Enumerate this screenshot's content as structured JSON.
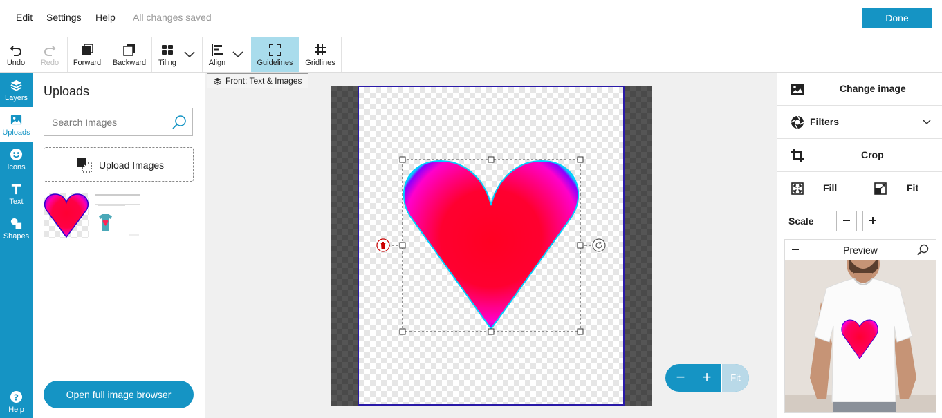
{
  "menu": {
    "items": [
      "Edit",
      "Settings",
      "Help"
    ],
    "status": "All changes saved",
    "done_label": "Done"
  },
  "toolbar": {
    "undo": "Undo",
    "redo": "Redo",
    "forward": "Forward",
    "backward": "Backward",
    "tiling": "Tiling",
    "align": "Align",
    "guidelines": "Guidelines",
    "gridlines": "Gridlines"
  },
  "rail": {
    "items": [
      {
        "label": "Layers",
        "icon": "layers-icon"
      },
      {
        "label": "Uploads",
        "icon": "image-icon",
        "active": true
      },
      {
        "label": "Icons",
        "icon": "smiley-icon"
      },
      {
        "label": "Text",
        "icon": "text-icon"
      },
      {
        "label": "Shapes",
        "icon": "shapes-icon"
      }
    ],
    "help": "Help"
  },
  "uploads": {
    "title": "Uploads",
    "search_placeholder": "Search Images",
    "upload_label": "Upload Images",
    "open_browser_label": "Open full image browser"
  },
  "canvas": {
    "layer_label": "Front: Text & Images",
    "zoom_out": "−",
    "zoom_in": "+",
    "fit": "Fit"
  },
  "right": {
    "change_image": "Change image",
    "filters": "Filters",
    "crop": "Crop",
    "fill": "Fill",
    "fit": "Fit",
    "scale": "Scale",
    "preview_title": "Preview",
    "preview_dots": 8,
    "preview_active_dot": 0
  },
  "colors": {
    "accent": "#1594c4",
    "print_border": "#2a1aa8",
    "heart_center": "#ff0033",
    "heart_edge": "#8a00ff"
  }
}
